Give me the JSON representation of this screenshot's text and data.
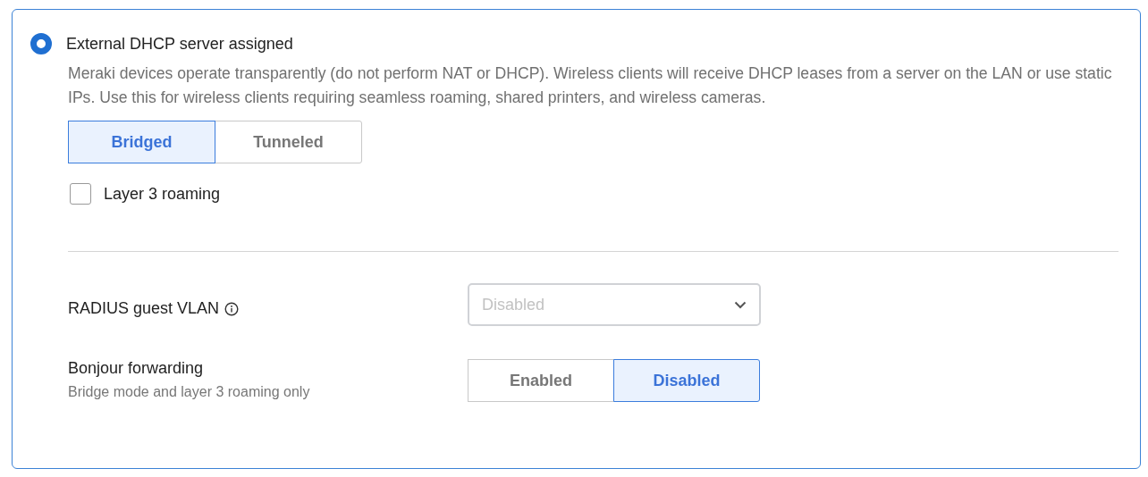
{
  "option": {
    "label": "External DHCP server assigned",
    "selected": true,
    "description": "Meraki devices operate transparently (do not perform NAT or DHCP). Wireless clients will receive DHCP leases from a server on the LAN or use static IPs. Use this for wireless clients requiring seamless roaming, shared printers, and wireless cameras."
  },
  "mode": [
    {
      "label": "Bridged",
      "selected": true
    },
    {
      "label": "Tunneled",
      "selected": false
    }
  ],
  "layer3_roaming": {
    "label": "Layer 3 roaming",
    "checked": false
  },
  "radius_guest_vlan": {
    "label": "RADIUS guest VLAN",
    "value": "Disabled",
    "disabled": true
  },
  "bonjour_forwarding": {
    "label": "Bonjour forwarding",
    "hint": "Bridge mode and layer 3 roaming only",
    "options": [
      {
        "label": "Enabled",
        "selected": false
      },
      {
        "label": "Disabled",
        "selected": true
      }
    ]
  }
}
